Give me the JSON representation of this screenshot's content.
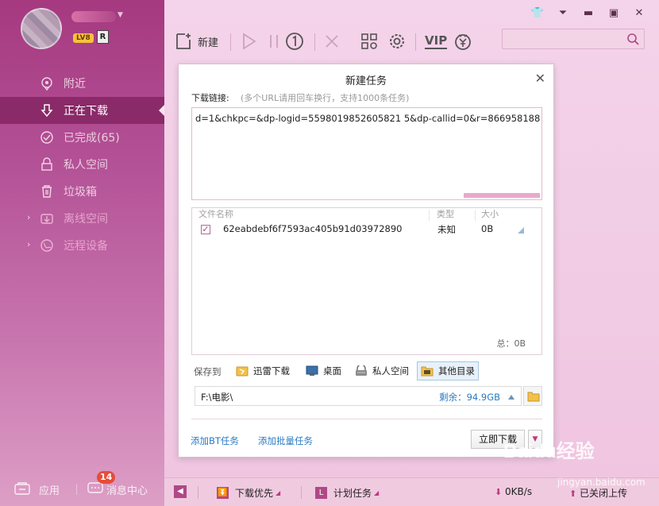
{
  "sidebar": {
    "level_badge": "LV8",
    "vip_mark": "R",
    "nav": [
      {
        "label": "附近"
      },
      {
        "label": "正在下载"
      },
      {
        "label": "已完成(65)"
      },
      {
        "label": "私人空间"
      },
      {
        "label": "垃圾箱"
      },
      {
        "label": "离线空间"
      },
      {
        "label": "远程设备"
      }
    ],
    "apps_label": "应用",
    "messages_label": "消息中心",
    "messages_count": "14"
  },
  "toolbar": {
    "new_label": "新建",
    "vip_label": "VIP"
  },
  "dialog": {
    "title": "新建任务",
    "link_label": "下载链接:",
    "link_hint": "(多个URL请用回车换行，支持1000条任务)",
    "url": "d=1&chkpc=&dp-logid=5598019852605821 5&dp-callid=0&r=866958188",
    "columns": {
      "name": "文件名称",
      "type": "类型",
      "size": "大小"
    },
    "files": [
      {
        "name": "62eabdebf6f7593ac405b91d03972890",
        "type": "未知",
        "size": "0B"
      }
    ],
    "total": "总：0B",
    "save_to_label": "保存到",
    "save_options": [
      "迅雷下载",
      "桌面",
      "私人空间",
      "其他目录"
    ],
    "path": "F:\\电影\\",
    "free_space": "剩余：94.9GB",
    "add_bt": "添加BT任务",
    "add_batch": "添加批量任务",
    "start_button": "立即下载"
  },
  "bottom_bar": {
    "priority": "下载优先",
    "schedule": "计划任务",
    "speed": "0KB/s",
    "upload": "已关闭上传"
  },
  "watermark": {
    "text": "Baidu经验",
    "sub": "jingyan.baidu.com"
  }
}
